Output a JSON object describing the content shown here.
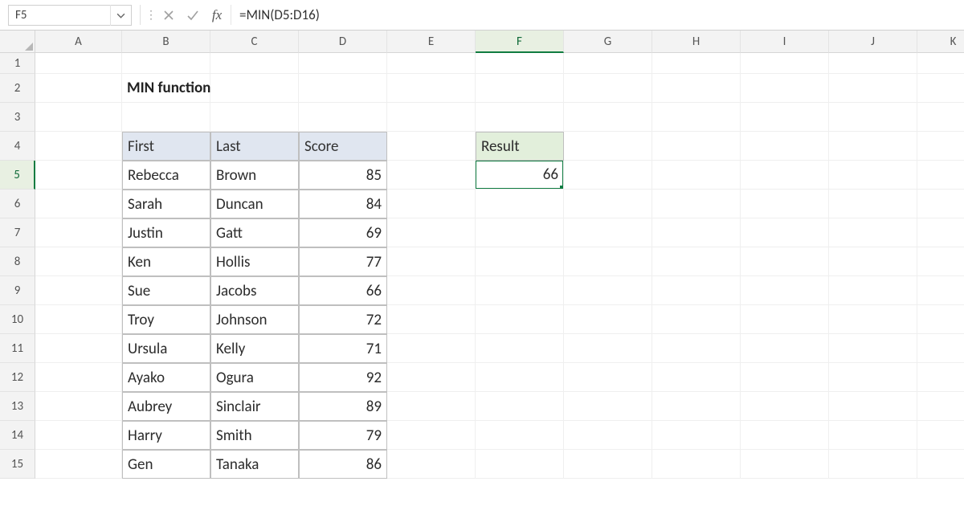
{
  "name_box": "F5",
  "formula": "=MIN(D5:D16)",
  "columns": [
    "A",
    "B",
    "C",
    "D",
    "E",
    "F",
    "G",
    "H",
    "I",
    "J",
    "K"
  ],
  "row_numbers": [
    "1",
    "2",
    "3",
    "4",
    "5",
    "6",
    "7",
    "8",
    "9",
    "10",
    "11",
    "12",
    "13",
    "14",
    "15"
  ],
  "title": "MIN function",
  "table": {
    "headers": {
      "first": "First",
      "last": "Last",
      "score": "Score"
    },
    "rows": [
      {
        "first": "Rebecca",
        "last": "Brown",
        "score": "85"
      },
      {
        "first": "Sarah",
        "last": "Duncan",
        "score": "84"
      },
      {
        "first": "Justin",
        "last": "Gatt",
        "score": "69"
      },
      {
        "first": "Ken",
        "last": "Hollis",
        "score": "77"
      },
      {
        "first": "Sue",
        "last": "Jacobs",
        "score": "66"
      },
      {
        "first": "Troy",
        "last": "Johnson",
        "score": "72"
      },
      {
        "first": "Ursula",
        "last": "Kelly",
        "score": "71"
      },
      {
        "first": "Ayako",
        "last": "Ogura",
        "score": "92"
      },
      {
        "first": "Aubrey",
        "last": "Sinclair",
        "score": "89"
      },
      {
        "first": "Harry",
        "last": "Smith",
        "score": "79"
      },
      {
        "first": "Gen",
        "last": "Tanaka",
        "score": "86"
      }
    ]
  },
  "result": {
    "label": "Result",
    "value": "66"
  },
  "active_cell": "F5",
  "selected_col": "F",
  "selected_row": "5"
}
